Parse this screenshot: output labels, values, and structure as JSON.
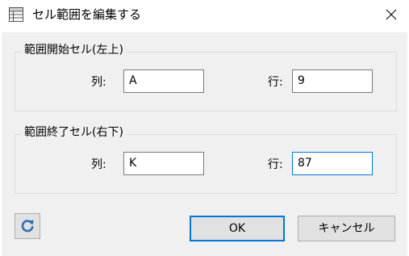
{
  "window": {
    "title": "セル範囲を編集する",
    "icon": "spreadsheet-icon",
    "close_icon": "close-icon"
  },
  "start_group": {
    "title": "範囲開始セル(左上)",
    "column_label": "列:",
    "column_value": "A",
    "row_label": "行:",
    "row_value": "9"
  },
  "end_group": {
    "title": "範囲終了セル(右下)",
    "column_label": "列:",
    "column_value": "K",
    "row_label": "行:",
    "row_value": "87"
  },
  "footer": {
    "refresh_icon": "refresh-icon",
    "ok_label": "OK",
    "cancel_label": "キャンセル"
  },
  "colors": {
    "accent": "#0078d7",
    "refresh_icon": "#2f6db5",
    "client_background": "#f0f0f0"
  }
}
